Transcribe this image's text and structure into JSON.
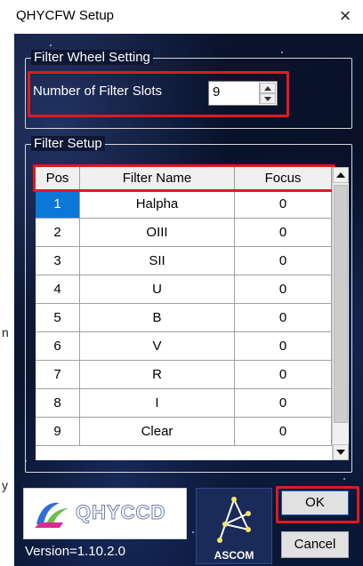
{
  "background_page": {
    "chars": [
      "n",
      "y"
    ]
  },
  "window": {
    "title": "QHYCFW Setup",
    "close_glyph": "×"
  },
  "filter_wheel_group": {
    "label": "Filter Wheel Setting",
    "slots_label": "Number of Filter Slots",
    "slots_value": "9"
  },
  "filter_setup_group": {
    "label": "Filter Setup",
    "columns": [
      "Pos",
      "Filter Name",
      "Focus"
    ],
    "selected_row": 0,
    "rows": [
      {
        "pos": "1",
        "name": "Halpha",
        "focus": "0"
      },
      {
        "pos": "2",
        "name": "OIII",
        "focus": "0"
      },
      {
        "pos": "3",
        "name": "SII",
        "focus": "0"
      },
      {
        "pos": "4",
        "name": "U",
        "focus": "0"
      },
      {
        "pos": "5",
        "name": "B",
        "focus": "0"
      },
      {
        "pos": "6",
        "name": "V",
        "focus": "0"
      },
      {
        "pos": "7",
        "name": "R",
        "focus": "0"
      },
      {
        "pos": "8",
        "name": "I",
        "focus": "0"
      },
      {
        "pos": "9",
        "name": "Clear",
        "focus": "0"
      }
    ]
  },
  "footer": {
    "logo_text": "QHYCCD",
    "version": "Version=1.10.2.0",
    "ascom_label": "ASCOM",
    "ok_label": "OK",
    "cancel_label": "Cancel"
  },
  "colors": {
    "highlight_border": "#e0191f",
    "selection": "#0b78d7",
    "dialog_background": "#0b1530"
  }
}
